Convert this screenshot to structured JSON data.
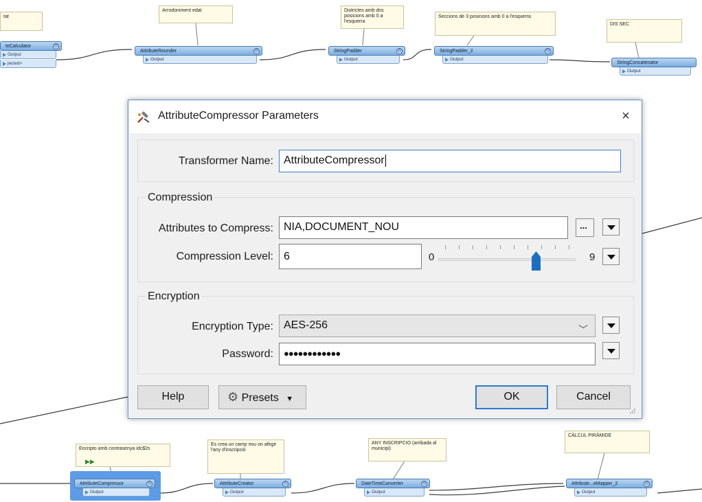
{
  "canvas": {
    "annotations": [
      {
        "id": "ann-top-left",
        "text": "tat"
      },
      {
        "id": "ann-rounder",
        "text": "Arrodoniment edat"
      },
      {
        "id": "ann-padder",
        "text": "Districtes amb dos posicions amb 0 a l'esquerra"
      },
      {
        "id": "ann-padder2",
        "text": "Seccions de 3 posicions amb 0 a l'esquerra"
      },
      {
        "id": "ann-concat",
        "text": "DIS SEC"
      },
      {
        "id": "ann-compressor",
        "text": "Encripto amb contrasenya idc$2s"
      },
      {
        "id": "ann-creator",
        "text": "Es crea un camp nou on afegir l'any d'inscripció"
      },
      {
        "id": "ann-datetime",
        "text": "ANY INSCRIPCIO (arribada al municipi)"
      },
      {
        "id": "ann-mapper",
        "text": "CÀLCUL PIRÀMIDE"
      }
    ],
    "nodes": [
      {
        "id": "calculator",
        "name": "teCalculator",
        "port": "Output",
        "port2": "jected>"
      },
      {
        "id": "rounder",
        "name": "AttributeRounder",
        "port": "Output"
      },
      {
        "id": "padder",
        "name": "StringPadder",
        "port": "Output"
      },
      {
        "id": "padder2",
        "name": "StringPadder_2",
        "port": "Output"
      },
      {
        "id": "concat",
        "name": "StringConcatenator",
        "port": "Output"
      },
      {
        "id": "compressor",
        "name": "AttributeCompressor",
        "port": "Output"
      },
      {
        "id": "creator",
        "name": "AttributeCreator",
        "port": "Output"
      },
      {
        "id": "datetime",
        "name": "DateTimeConverter",
        "port": "Output"
      },
      {
        "id": "mapper",
        "name": "Attribute...eMapper_2",
        "port": "Output"
      }
    ]
  },
  "dialog": {
    "title": "AttributeCompressor Parameters",
    "close_glyph": "×",
    "transformer_name_label": "Transformer Name:",
    "transformer_name_value": "AttributeCompressor",
    "compression": {
      "group_title": "Compression",
      "attributes_label": "Attributes to Compress:",
      "attributes_value": "NIA,DOCUMENT_NOU",
      "ellipsis": "...",
      "level_label": "Compression Level:",
      "level_value": "6",
      "slider_min": "0",
      "slider_max": "9",
      "slider_value": 6
    },
    "encryption": {
      "group_title": "Encryption",
      "type_label": "Encryption Type:",
      "type_value": "AES-256",
      "password_label": "Password:",
      "password_value": "●●●●●●●●●●●●"
    },
    "buttons": {
      "help": "Help",
      "presets": "Presets",
      "ok": "OK",
      "cancel": "Cancel"
    }
  },
  "colors": {
    "accent": "#2f78d0",
    "node_blue": "#7eaee0",
    "annotation_bg": "#fffbe6",
    "slider_thumb": "#1b6fc2"
  }
}
